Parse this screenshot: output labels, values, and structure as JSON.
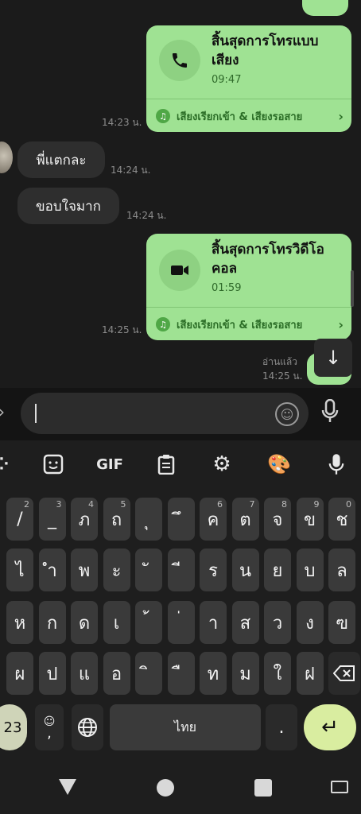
{
  "chat": {
    "calls": [
      {
        "title": "สิ้นสุดการโทรแบบเสียง",
        "duration": "09:47",
        "footer": "เสียงเรียกเข้า & เสียงรอสาย",
        "timestamp": "14:23 น.",
        "icon": "phone-icon"
      },
      {
        "title": "สิ้นสุดการโทรวิดีโอคอล",
        "duration": "01:59",
        "footer": "เสียงเรียกเข้า & เสียงรอสาย",
        "timestamp": "14:25 น.",
        "icon": "video-camera-icon"
      }
    ],
    "incoming": [
      {
        "text": "พี่แตกละ",
        "timestamp": "14:24 น."
      },
      {
        "text": "ขอบใจมาก",
        "timestamp": "14:24 น."
      }
    ],
    "read_label": "อ่านแล้ว",
    "last_timestamp": "14:25 น.",
    "bubble_color": "#9fe293"
  },
  "composer": {
    "placeholder": ""
  },
  "keyboard": {
    "toolbar": {
      "gif_label": "GIF"
    },
    "row1": [
      {
        "k": "/",
        "h": "2"
      },
      {
        "k": "_",
        "h": "3"
      },
      {
        "k": "ภ",
        "h": "4"
      },
      {
        "k": "ถ",
        "h": "5"
      },
      {
        "k": "ุ",
        "h": ""
      },
      {
        "k": "ึ",
        "h": ""
      },
      {
        "k": "ค",
        "h": "6"
      },
      {
        "k": "ต",
        "h": "7"
      },
      {
        "k": "จ",
        "h": "8"
      },
      {
        "k": "ข",
        "h": "9"
      },
      {
        "k": "ช",
        "h": "0"
      }
    ],
    "row2": [
      {
        "k": "ไ",
        "h": ""
      },
      {
        "k": "ำ",
        "h": ""
      },
      {
        "k": "พ",
        "h": ""
      },
      {
        "k": "ะ",
        "h": ""
      },
      {
        "k": "ั",
        "h": ""
      },
      {
        "k": "ี",
        "h": ""
      },
      {
        "k": "ร",
        "h": ""
      },
      {
        "k": "น",
        "h": ""
      },
      {
        "k": "ย",
        "h": ""
      },
      {
        "k": "บ",
        "h": ""
      },
      {
        "k": "ล",
        "h": ""
      }
    ],
    "row3": [
      {
        "k": "ห",
        "h": ""
      },
      {
        "k": "ก",
        "h": ""
      },
      {
        "k": "ด",
        "h": ""
      },
      {
        "k": "เ",
        "h": ""
      },
      {
        "k": "้",
        "h": ""
      },
      {
        "k": "่",
        "h": ""
      },
      {
        "k": "า",
        "h": ""
      },
      {
        "k": "ส",
        "h": ""
      },
      {
        "k": "ว",
        "h": ""
      },
      {
        "k": "ง",
        "h": ""
      },
      {
        "k": "ฃ",
        "h": ""
      }
    ],
    "row4": [
      {
        "k": "ผ",
        "h": ""
      },
      {
        "k": "ป",
        "h": ""
      },
      {
        "k": "แ",
        "h": ""
      },
      {
        "k": "อ",
        "h": ""
      },
      {
        "k": "ิ",
        "h": ""
      },
      {
        "k": "ื",
        "h": ""
      },
      {
        "k": "ท",
        "h": ""
      },
      {
        "k": "ม",
        "h": ""
      },
      {
        "k": "ใ",
        "h": ""
      },
      {
        "k": "ฝ",
        "h": ""
      }
    ],
    "numbers_key": "23",
    "comma_key": ",",
    "emoji_hint": "☺",
    "space_label": "ไทย",
    "period_key": ".",
    "enter_key": "↵",
    "accent_color": "#d9eda0"
  }
}
